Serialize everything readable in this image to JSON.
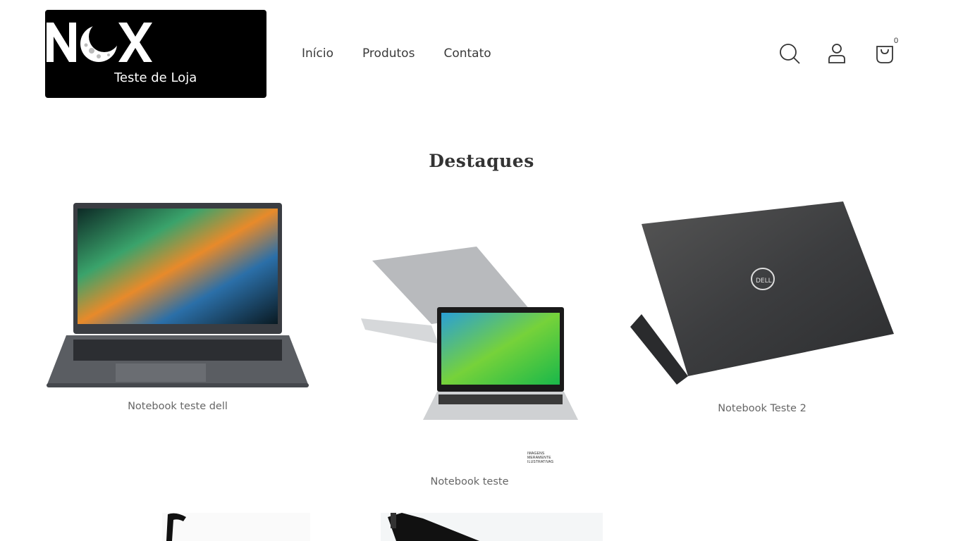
{
  "header": {
    "logo_text": "NOX",
    "logo_subtitle": "Teste de Loja",
    "nav": [
      {
        "label": "Início"
      },
      {
        "label": "Produtos"
      },
      {
        "label": "Contato"
      }
    ],
    "cart_count": "0"
  },
  "section": {
    "title": "Destaques"
  },
  "products": [
    {
      "name": "Notebook teste dell",
      "image": "acer-laptop-open-front"
    },
    {
      "name": "Notebook teste",
      "image": "acer-laptops-silver-pair",
      "caption": "IMAGENS MERAMENTE ILUSTRATIVAS"
    },
    {
      "name": "Notebook Teste 2",
      "image": "dell-laptop-back-gray"
    },
    {
      "name": "",
      "image": "product-partial-black-1"
    },
    {
      "name": "",
      "image": "product-partial-black-2"
    }
  ],
  "colors": {
    "logo_bg": "#000000",
    "text": "#333333",
    "muted": "#666666"
  }
}
